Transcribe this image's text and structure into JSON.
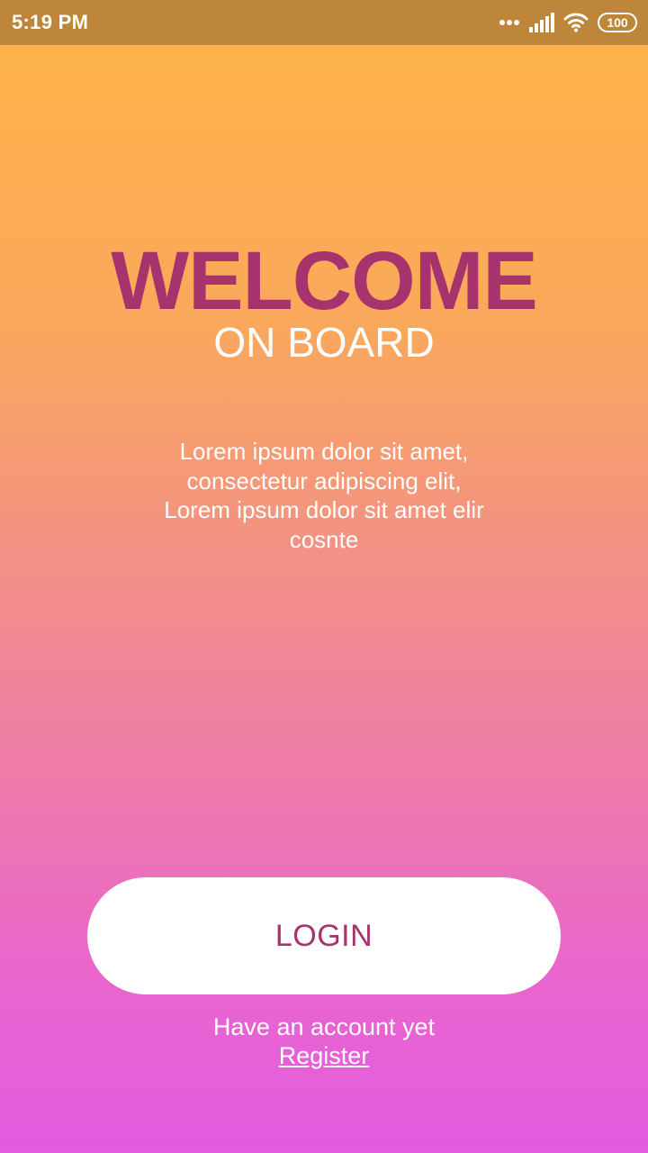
{
  "status_bar": {
    "time": "5:19 PM",
    "battery_level": "100",
    "icons": [
      "more-dots-icon",
      "signal-icon",
      "wifi-icon",
      "battery-icon"
    ]
  },
  "hero": {
    "title": "WELCOME",
    "subtitle": "ON BOARD"
  },
  "description": {
    "lines": [
      "Lorem ipsum dolor sit amet,",
      "consectetur adipiscing elit,",
      "Lorem ipsum dolor sit amet elir",
      "cosnte"
    ]
  },
  "actions": {
    "login_label": "LOGIN",
    "account_prompt": "Have an account yet",
    "register_label": "Register"
  },
  "colors": {
    "status_bar": "#BE863A",
    "gradient_top": "#FFB446",
    "gradient_bottom": "#E35CE1",
    "accent": "#A6336E",
    "button_bg": "#FFFFFF"
  }
}
